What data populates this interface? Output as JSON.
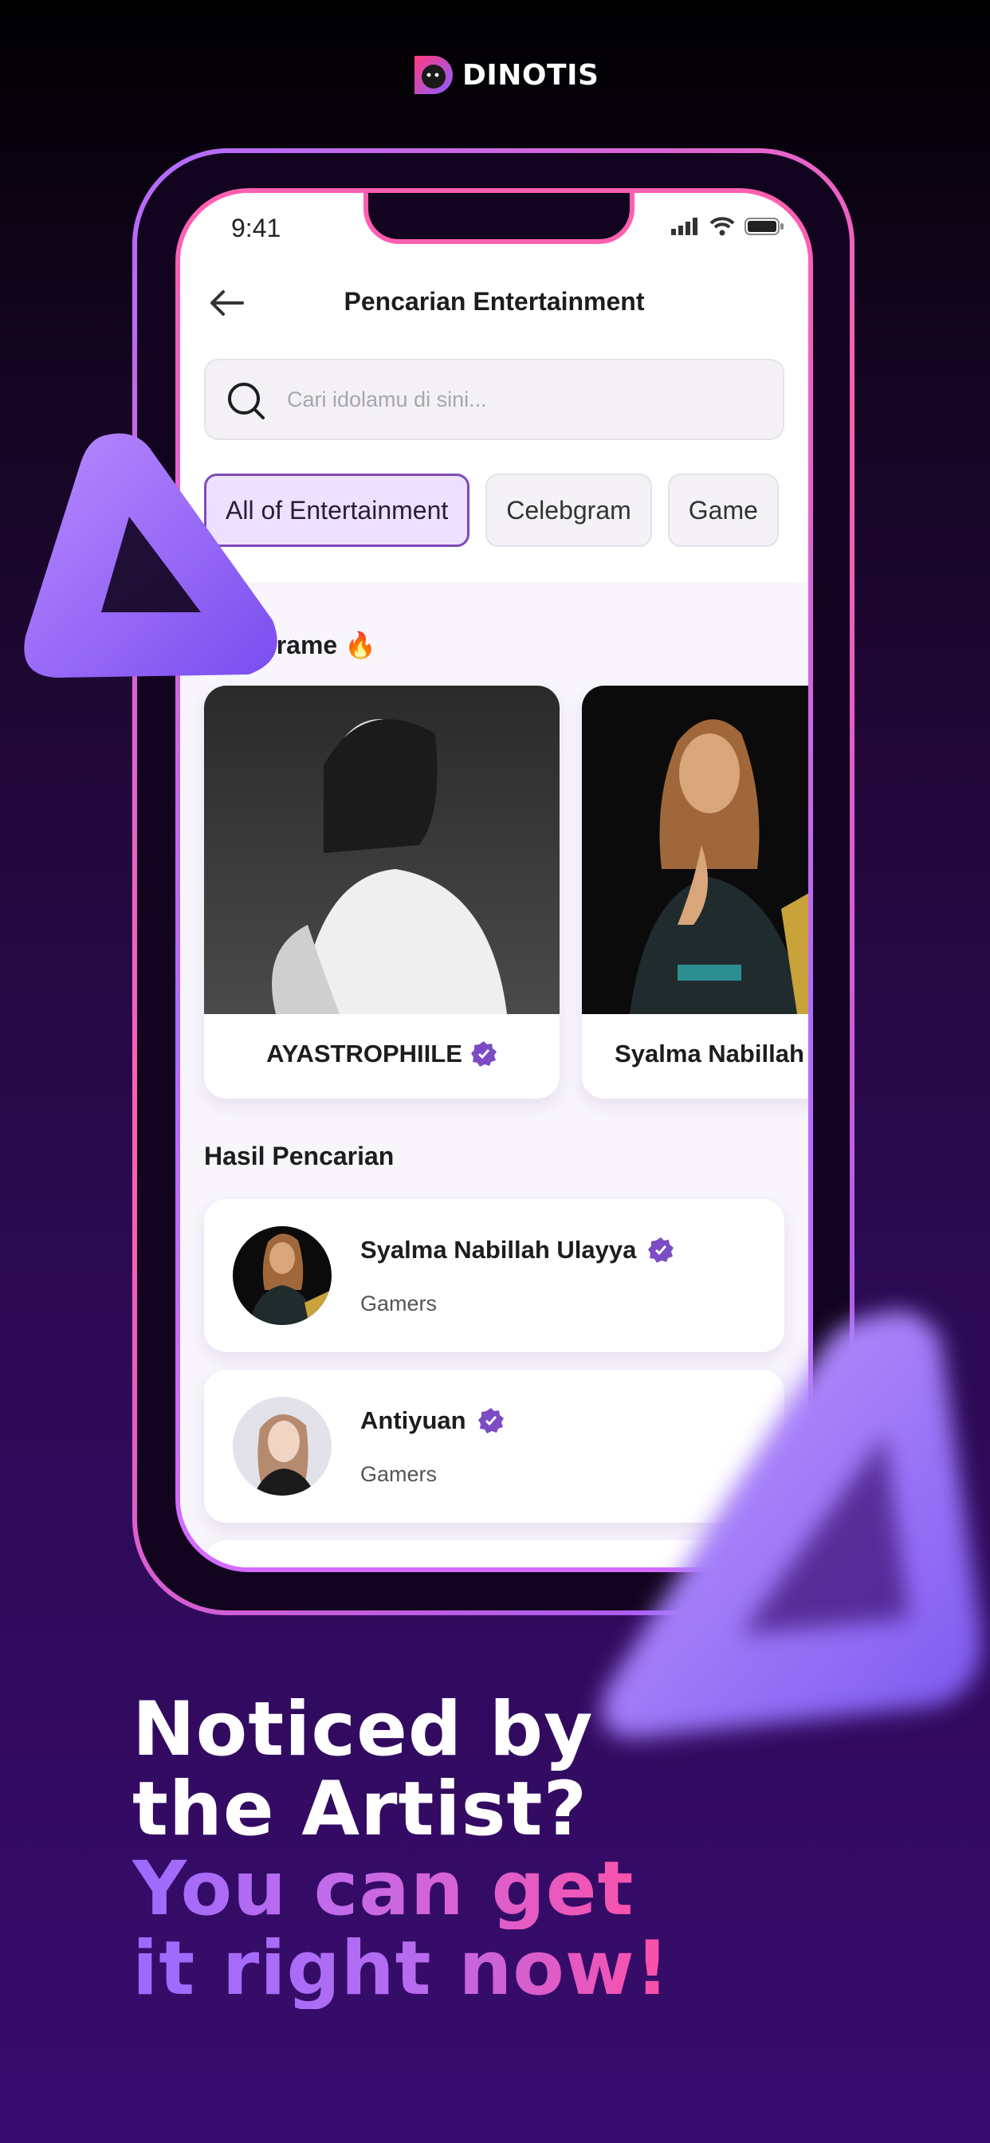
{
  "brand": {
    "name": "DINOTIS"
  },
  "status": {
    "time": "9:41"
  },
  "header": {
    "title": "Pencarian Entertainment"
  },
  "search": {
    "placeholder": "Cari idolamu di sini..."
  },
  "chips": [
    "All of Entertainment",
    "Celebgram",
    "Game"
  ],
  "trending": {
    "title": "...lagi rame 🔥",
    "cards": [
      {
        "name": "AYASTROPHIILE",
        "verified": true
      },
      {
        "name": "Syalma Nabillah",
        "verified": true
      }
    ]
  },
  "results": {
    "title": "Hasil Pencarian",
    "items": [
      {
        "name": "Syalma Nabillah Ulayya",
        "category": "Gamers",
        "verified": true
      },
      {
        "name": "Antiyuan",
        "category": "Gamers",
        "verified": true
      }
    ]
  },
  "headline": {
    "line1": "Noticed by",
    "line2": "the Artist?",
    "line3": "You can get",
    "line4": "it right now!"
  },
  "colors": {
    "accent": "#7d4bb8",
    "pink": "#ff4fa6",
    "purple": "#9b6bff",
    "verified": "#7b4cc4"
  }
}
